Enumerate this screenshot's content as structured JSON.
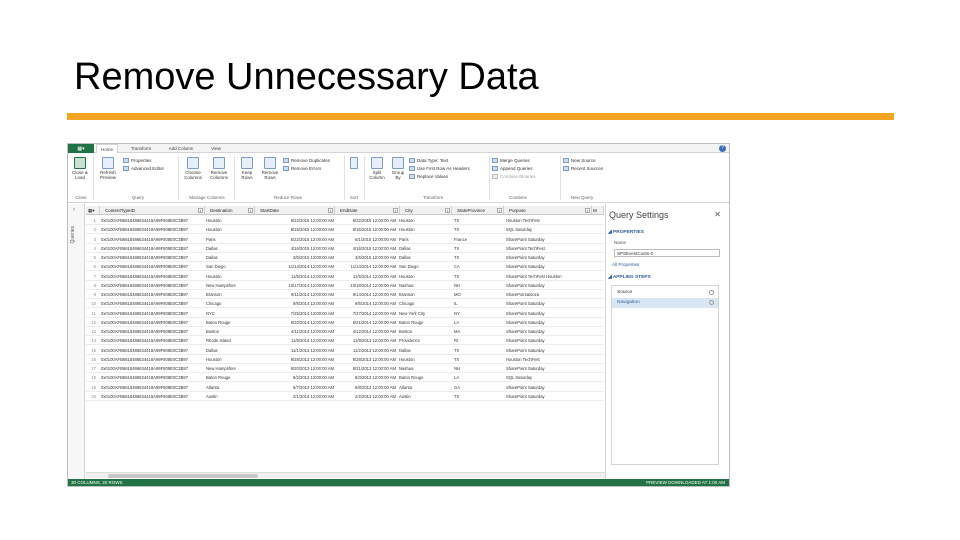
{
  "slide": {
    "title": "Remove Unnecessary Data",
    "accent_color": "#f4a523"
  },
  "app": {
    "file_tab": "File",
    "tabs": [
      "Home",
      "Transform",
      "Add Column",
      "View"
    ],
    "active_tab": "Home",
    "ribbon": {
      "close_load": "Close & Load",
      "refresh_preview": "Refresh Preview",
      "properties": "Properties",
      "advanced_editor": "Advanced Editor",
      "choose_columns": "Choose Columns",
      "remove_columns": "Remove Columns",
      "keep_rows": "Keep Rows",
      "remove_rows": "Remove Rows",
      "remove_duplicates": "Remove Duplicates",
      "remove_errors": "Remove Errors",
      "split_column": "Split Column",
      "group_by": "Group By",
      "data_type": "Data Type: Text",
      "use_first_row": "Use First Row As Headers",
      "replace_values": "Replace Values",
      "merge_queries": "Merge Queries",
      "append_queries": "Append Queries",
      "combine_binaries": "Combine Binaries",
      "new_source": "New Source",
      "recent_sources": "Recent Sources",
      "groups": {
        "close": "Close",
        "query": "Query",
        "manage_columns": "Manage Columns",
        "reduce_rows": "Reduce Rows",
        "sort": "Sort",
        "transform": "Transform",
        "combine": "Combine",
        "new_query": "New Query"
      }
    },
    "queries_label": "Queries",
    "columns": [
      "ContentTypeID",
      "Destination",
      "StartDate",
      "EndDate",
      "City",
      "StateProvince",
      "Purpose"
    ],
    "rows": [
      {
        "id": "0x0100AFB6618486634418A99F808E0C3B97",
        "dest": "Houston",
        "start": "6/22/2015 12:00:00 AM",
        "end": "6/22/2015 12:00:00 AM",
        "city": "Houston",
        "state": "TX",
        "purpose": "Houston TechFest"
      },
      {
        "id": "0x0100AFB6618486634418A99F808E0C3B97",
        "dest": "Houston",
        "start": "8/15/2015 12:00:00 AM",
        "end": "8/15/2015 12:00:00 AM",
        "city": "Houston",
        "state": "TX",
        "purpose": "SQL Saturday"
      },
      {
        "id": "0x0100AFB6618486634418A99F808E0C3B97",
        "dest": "Paris",
        "start": "5/22/2015 12:00:00 AM",
        "end": "6/1/2015 12:00:00 AM",
        "city": "Paris",
        "state": "France",
        "purpose": "SharePoint Saturday"
      },
      {
        "id": "0x0100AFB6618486634418A99F808E0C3B97",
        "dest": "Dallas",
        "start": "4/16/2015 12:00:00 AM",
        "end": "4/16/2015 12:00:00 AM",
        "city": "Dallas",
        "state": "TX",
        "purpose": "SharePoint TechFest"
      },
      {
        "id": "0x0100AFB6618486634418A99F808E0C3B97",
        "dest": "Dallas",
        "start": "3/6/2015 12:00:00 AM",
        "end": "3/6/2015 12:00:00 AM",
        "city": "Dallas",
        "state": "TX",
        "purpose": "SharePoint Saturday"
      },
      {
        "id": "0x0100AFB6618486634418A99F808E0C3B97",
        "dest": "San Diego",
        "start": "11/14/2014 12:00:00 AM",
        "end": "11/14/2014 12:00:00 AM",
        "city": "San Diego",
        "state": "CA",
        "purpose": "SharePoint Saturday"
      },
      {
        "id": "0x0100AFB6618486634418A99F808E0C3B97",
        "dest": "Houston",
        "start": "11/5/2014 12:00:00 AM",
        "end": "11/5/2014 12:00:00 AM",
        "city": "Houston",
        "state": "TX",
        "purpose": "SharePoint TechFest Houston"
      },
      {
        "id": "0x0100AFB6618486634418A99F808E0C3B97",
        "dest": "New Hampshire",
        "start": "10/17/2014 12:00:00 AM",
        "end": "10/18/2014 12:00:00 AM",
        "city": "Nashua",
        "state": "NH",
        "purpose": "SharePoint Saturday"
      },
      {
        "id": "0x0100AFB6618486634418A99F808E0C3B97",
        "dest": "Branson",
        "start": "9/11/2014 12:00:00 AM",
        "end": "9/14/2014 12:00:00 AM",
        "city": "Branson",
        "state": "MO",
        "purpose": "SharePointalooza"
      },
      {
        "id": "0x0100AFB6618486634418A99F808E0C3B97",
        "dest": "Chicago",
        "start": "9/5/2014 12:00:00 AM",
        "end": "9/5/2014 12:00:00 AM",
        "city": "Chicago",
        "state": "IL",
        "purpose": "SharePoint Saturday"
      },
      {
        "id": "0x0100AFB6618486634418A99F808E0C3B97",
        "dest": "NYC",
        "start": "7/25/2014 12:00:00 AM",
        "end": "7/27/2014 12:00:00 AM",
        "city": "New York City",
        "state": "NY",
        "purpose": "SharePoint Saturday"
      },
      {
        "id": "0x0100AFB6618486634418A99F808E0C3B97",
        "dest": "Baton Rouge",
        "start": "6/20/2014 12:00:00 AM",
        "end": "6/21/2014 12:00:00 AM",
        "city": "Baton Rouge",
        "state": "LA",
        "purpose": "SharePoint Saturday"
      },
      {
        "id": "0x0100AFB6618486634418A99F808E0C3B97",
        "dest": "Boston",
        "start": "4/11/2014 12:00:00 AM",
        "end": "4/12/2014 12:00:00 AM",
        "city": "Boston",
        "state": "MA",
        "purpose": "SharePoint Saturday"
      },
      {
        "id": "0x0100AFB6618486634418A99F808E0C3B97",
        "dest": "Rhode Island",
        "start": "11/8/2013 12:00:00 AM",
        "end": "11/9/2013 12:00:00 AM",
        "city": "Providence",
        "state": "RI",
        "purpose": "SharePoint Saturday"
      },
      {
        "id": "0x0100AFB6618486634418A99F808E0C3B97",
        "dest": "Dallas",
        "start": "11/1/2013 12:00:00 AM",
        "end": "11/2/2013 12:00:00 AM",
        "city": "Dallas",
        "state": "TX",
        "purpose": "SharePoint Saturday"
      },
      {
        "id": "0x0100AFB6618486634418A99F808E0C3B97",
        "dest": "Houston",
        "start": "9/28/2013 12:00:00 AM",
        "end": "9/28/2013 12:00:00 AM",
        "city": "Houston",
        "state": "TX",
        "purpose": "Houston TechFest"
      },
      {
        "id": "0x0100AFB6618486634418A99F808E0C3B97",
        "dest": "New Hampshire",
        "start": "9/20/2013 12:00:00 AM",
        "end": "9/21/2013 12:00:00 AM",
        "city": "Nashua",
        "state": "NH",
        "purpose": "SharePoint Saturday"
      },
      {
        "id": "0x0100AFB6618486634418A99F808E0C3B97",
        "dest": "Baton Rouge",
        "start": "8/2/2013 12:00:00 AM",
        "end": "8/3/2013 12:00:00 AM",
        "city": "Baton Rouge",
        "state": "LA",
        "purpose": "SQL Saturday"
      },
      {
        "id": "0x0100AFB6618486634418A99F808E0C3B97",
        "dest": "Atlanta",
        "start": "6/7/2013 12:00:00 AM",
        "end": "6/8/2013 12:00:00 AM",
        "city": "Atlanta",
        "state": "GA",
        "purpose": "SharePoint Saturday"
      },
      {
        "id": "0x0100AFB6618486634418A99F808E0C3B97",
        "dest": "Austin",
        "start": "2/1/2013 12:00:00 AM",
        "end": "2/2/2013 12:00:00 AM",
        "city": "Austin",
        "state": "TX",
        "purpose": "SharePoint Saturday"
      }
    ],
    "settings": {
      "title": "Query Settings",
      "properties_header": "PROPERTIES",
      "name_label": "Name",
      "name_value": "SPSEventCosts-2",
      "all_properties": "All Properties",
      "applied_steps_header": "APPLIED STEPS",
      "steps": [
        "Source",
        "Navigation"
      ],
      "selected_step": "Navigation"
    },
    "status_left": "30 COLUMNS, 20 ROWS",
    "status_right": "PREVIEW DOWNLOADED AT 1:00 AM",
    "brand_color": "#217346"
  }
}
